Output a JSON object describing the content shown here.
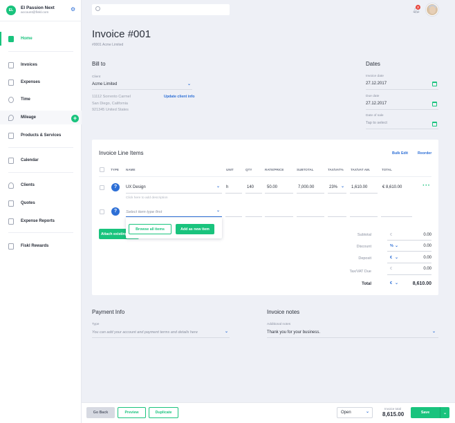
{
  "org": {
    "initials": "EL",
    "name": "El Passion Next",
    "email": "account@fiskl.com"
  },
  "nav": [
    {
      "label": "Home",
      "icon": "home-icon"
    },
    {
      "label": "Invoices",
      "icon": "invoice-icon"
    },
    {
      "label": "Expenses",
      "icon": "expenses-icon"
    },
    {
      "label": "Time",
      "icon": "clock-icon"
    },
    {
      "label": "Mileage",
      "icon": "location-pin-icon"
    },
    {
      "label": "Products & Services",
      "icon": "box-icon"
    },
    {
      "label": "Calendar",
      "icon": "calendar-icon"
    },
    {
      "label": "Clients",
      "icon": "clients-icon"
    },
    {
      "label": "Quotes",
      "icon": "quotes-icon"
    },
    {
      "label": "Expense Reports",
      "icon": "report-icon"
    },
    {
      "label": "Fiskl Rewards",
      "icon": "rewards-icon"
    }
  ],
  "topbar": {
    "search_placeholder": "",
    "notification_count": "2"
  },
  "invoice": {
    "title": "Invoice #001",
    "subtitle": "#0001 Acme Limited"
  },
  "bill_to": {
    "title": "Bill to",
    "client_label": "Client",
    "client_value": "Acme Limited",
    "address": [
      "11112 Sorrento Carmel",
      "San Diego, California",
      "921345 United States"
    ],
    "update_link": "Update client info"
  },
  "dates": {
    "title": "Dates",
    "invoice_date_label": "Invoice date",
    "invoice_date": "27.12.2017",
    "due_date_label": "Due date",
    "due_date": "27.12.2017",
    "date_of_sale_label": "Date of sale",
    "date_of_sale_placeholder": "Tap to select"
  },
  "line_items": {
    "title": "Invoice Line Items",
    "bulk_edit": "Bulk Edit",
    "reorder": "Reorder",
    "columns": [
      "TYPE",
      "NAME",
      "UNIT",
      "QTY",
      "RATE/PRICE",
      "SUBTOTAL",
      "TAX/VAT%",
      "TAX/VAT AM.",
      "TOTAL"
    ],
    "rows": [
      {
        "name": "UX Design",
        "description_placeholder": "Click here to add description",
        "unit": "h",
        "qty": "140",
        "rate": "50.00",
        "subtotal": "7,000.00",
        "tax_pct": "23%",
        "tax_amount": "1,610.00",
        "total": "€ 8,610.00"
      }
    ],
    "new_row_placeholder": "Select item type first",
    "dropdown": {
      "browse": "Browse all items",
      "add_new": "Add as new item"
    },
    "attach_button": "Attach existing"
  },
  "totals": {
    "subtotal_label": "Subtotal",
    "subtotal_cur": "€",
    "subtotal": "0.00",
    "discount_label": "Discount",
    "discount_cur": "%",
    "discount": "0.00",
    "deposit_label": "Deposit",
    "deposit_cur": "€",
    "deposit": "0.00",
    "tax_label": "Tax/VAT Due",
    "tax_cur": "€",
    "tax": "0.00",
    "total_label": "Total",
    "total_cur": "€",
    "total": "8,610.00"
  },
  "payment": {
    "title": "Payment Info",
    "type_label": "Type",
    "type_placeholder": "You can add your account and payment terms and details here"
  },
  "notes": {
    "title": "Invoice notes",
    "label": "Additional notes",
    "value": "Thank you for your business."
  },
  "bottom": {
    "go_back": "Go Back",
    "preview": "Preview",
    "duplicate": "Duplicate",
    "status": "Open",
    "invoice_total_label": "Invoice total",
    "invoice_total": "8,615.00",
    "save": "Save"
  },
  "colors": {
    "accent": "#19c37d",
    "link": "#2d6fd6",
    "badge": "#e8453c"
  }
}
